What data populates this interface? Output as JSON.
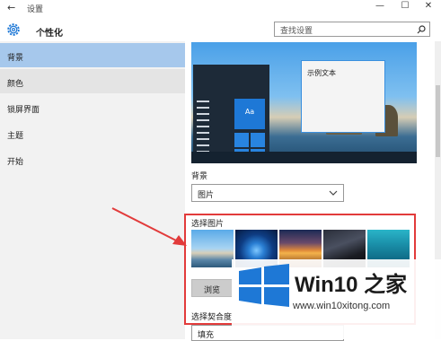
{
  "window": {
    "title": "设置",
    "back_glyph": "←",
    "minimize_glyph": "—",
    "maximize_glyph": "☐",
    "close_glyph": "✕"
  },
  "header": {
    "title": "个性化",
    "icon": "gear-icon"
  },
  "search": {
    "placeholder": "查找设置",
    "icon": "search-icon"
  },
  "sidebar": {
    "items": [
      {
        "label": "背景",
        "active": true
      },
      {
        "label": "颜色",
        "active": false
      },
      {
        "label": "锁屏界面",
        "active": false
      },
      {
        "label": "主题",
        "active": false
      },
      {
        "label": "开始",
        "active": false
      }
    ]
  },
  "preview": {
    "tile_text": "Aa",
    "window_text": "示例文本"
  },
  "background": {
    "label": "背景",
    "value": "图片"
  },
  "choose_picture": {
    "label": "选择图片",
    "browse_label": "浏览",
    "thumbnails": [
      "beach",
      "windows-blue",
      "sunset",
      "night-sky",
      "underwater"
    ]
  },
  "fit": {
    "label": "选择契合度",
    "value": "填充"
  },
  "watermark": {
    "brand": "Win10 之家",
    "url": "www.win10xitong.com"
  },
  "colors": {
    "accent": "#a6c8ec",
    "highlight": "#e23b3b",
    "arrow": "#e23b3b",
    "logo": "#1e78d6"
  }
}
